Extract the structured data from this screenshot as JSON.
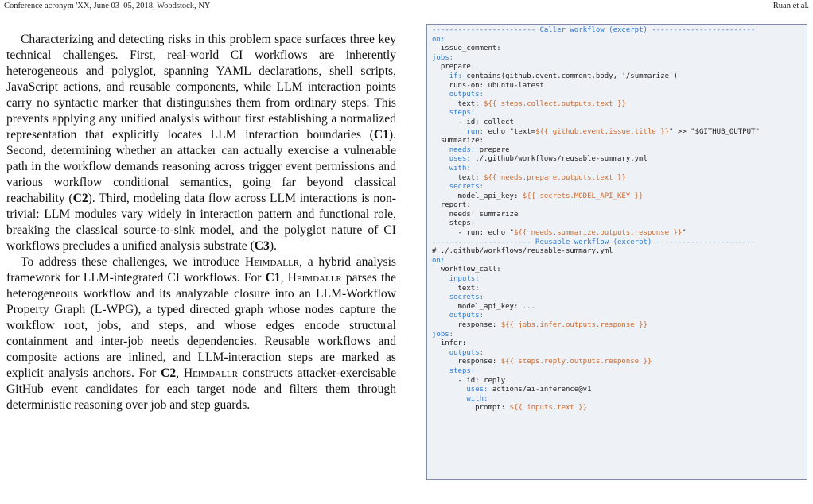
{
  "header": {
    "left": "Conference acronym 'XX, June 03–05, 2018, Woodstock, NY",
    "right": "Ruan et al."
  },
  "body": {
    "p1_segments": [
      {
        "t": "Characterizing and detecting risks in this problem space surfaces three key technical challenges. First, real-world CI workflows are inherently heterogeneous and polyglot, spanning YAML declarations, shell scripts, JavaScript actions, and reusable components, while LLM interaction points carry no syntactic marker that distinguishes them from ordinary steps. This prevents applying any unified analysis without first establishing a normalized representation that explicitly locates LLM interaction boundaries (",
        "s": ""
      },
      {
        "t": "C1",
        "s": "b"
      },
      {
        "t": "). Second, determining whether an attacker can actually exercise a vulnerable path in the workflow demands reasoning across trigger event permissions and various workflow conditional semantics, going far beyond classical reachability (",
        "s": ""
      },
      {
        "t": "C2",
        "s": "b"
      },
      {
        "t": "). Third, modeling data flow across LLM interactions is non-trivial: LLM modules vary widely in interaction pattern and functional role, breaking the classical source-to-sink model, and the polyglot nature of CI workflows precludes a unified analysis substrate (",
        "s": ""
      },
      {
        "t": "C3",
        "s": "b"
      },
      {
        "t": ").",
        "s": ""
      }
    ],
    "p2_segments": [
      {
        "t": "To address these challenges, we introduce ",
        "s": ""
      },
      {
        "t": "Heimdallr",
        "s": "sc"
      },
      {
        "t": ", a hybrid analysis framework for LLM-integrated CI workflows. For ",
        "s": ""
      },
      {
        "t": "C1",
        "s": "b"
      },
      {
        "t": ", ",
        "s": ""
      },
      {
        "t": "Heimdallr",
        "s": "sc"
      },
      {
        "t": " parses the heterogeneous workflow and its analyzable closure into an LLM-Workflow Property Graph (L-WPG), a typed directed graph whose nodes capture the workflow root, jobs, and steps, and whose edges encode structural containment and inter-job needs dependencies. Reusable workflows and composite actions are inlined, and LLM-interaction steps are marked as explicit analysis anchors. For ",
        "s": ""
      },
      {
        "t": "C2",
        "s": "b"
      },
      {
        "t": ", ",
        "s": ""
      },
      {
        "t": "Heimdallr",
        "s": "sc"
      },
      {
        "t": " constructs attacker-exercisable GitHub event candidates for each target node and filters them through deterministic reasoning over job and step guards.",
        "s": ""
      }
    ]
  },
  "code_lines": [
    [
      {
        "t": "------------------------ Caller workflow (excerpt) ------------------------",
        "c": "sep"
      }
    ],
    [
      {
        "t": "on:",
        "c": "kw"
      }
    ],
    [
      {
        "t": "  issue_comment:",
        "c": ""
      }
    ],
    [
      {
        "t": "jobs:",
        "c": "kw"
      }
    ],
    [
      {
        "t": "  prepare:",
        "c": ""
      }
    ],
    [
      {
        "t": "    ",
        "c": ""
      },
      {
        "t": "if:",
        "c": "kw"
      },
      {
        "t": " contains(github.event.comment.body, '/summarize')",
        "c": ""
      }
    ],
    [
      {
        "t": "    runs-on: ubuntu-latest",
        "c": ""
      }
    ],
    [
      {
        "t": "    ",
        "c": ""
      },
      {
        "t": "outputs:",
        "c": "kw"
      }
    ],
    [
      {
        "t": "      text: ",
        "c": ""
      },
      {
        "t": "${{ steps.collect.outputs.text }}",
        "c": "st"
      }
    ],
    [
      {
        "t": "    ",
        "c": ""
      },
      {
        "t": "steps:",
        "c": "kw"
      }
    ],
    [
      {
        "t": "      - id: collect",
        "c": ""
      }
    ],
    [
      {
        "t": "        ",
        "c": ""
      },
      {
        "t": "run:",
        "c": "kw"
      },
      {
        "t": " echo \"text=",
        "c": ""
      },
      {
        "t": "${{ github.event.issue.title }}",
        "c": "st"
      },
      {
        "t": "\" >> \"$GITHUB_OUTPUT\"",
        "c": ""
      }
    ],
    [
      {
        "t": "  summarize:",
        "c": ""
      }
    ],
    [
      {
        "t": "    ",
        "c": ""
      },
      {
        "t": "needs:",
        "c": "kw"
      },
      {
        "t": " prepare",
        "c": ""
      }
    ],
    [
      {
        "t": "    ",
        "c": ""
      },
      {
        "t": "uses:",
        "c": "kw"
      },
      {
        "t": " ./.github/workflows/reusable-summary.yml",
        "c": ""
      }
    ],
    [
      {
        "t": "    ",
        "c": ""
      },
      {
        "t": "with:",
        "c": "kw"
      }
    ],
    [
      {
        "t": "      text: ",
        "c": ""
      },
      {
        "t": "${{ needs.prepare.outputs.text }}",
        "c": "st"
      }
    ],
    [
      {
        "t": "    ",
        "c": ""
      },
      {
        "t": "secrets:",
        "c": "kw"
      }
    ],
    [
      {
        "t": "      model_api_key: ",
        "c": ""
      },
      {
        "t": "${{ secrets.MODEL_API_KEY }}",
        "c": "st"
      }
    ],
    [
      {
        "t": "  report:",
        "c": ""
      }
    ],
    [
      {
        "t": "    needs: summarize",
        "c": ""
      }
    ],
    [
      {
        "t": "    steps:",
        "c": ""
      }
    ],
    [
      {
        "t": "      - run: echo \"",
        "c": ""
      },
      {
        "t": "${{ needs.summarize.outputs.response }}",
        "c": "st"
      },
      {
        "t": "\"",
        "c": ""
      }
    ],
    [
      {
        "t": "----------------------- Reusable workflow (excerpt) -----------------------",
        "c": "sep"
      }
    ],
    [
      {
        "t": "# ./.github/workflows/reusable-summary.yml",
        "c": ""
      }
    ],
    [
      {
        "t": "on:",
        "c": "kw"
      }
    ],
    [
      {
        "t": "  workflow_call:",
        "c": ""
      }
    ],
    [
      {
        "t": "    ",
        "c": ""
      },
      {
        "t": "inputs:",
        "c": "kw"
      }
    ],
    [
      {
        "t": "      text:",
        "c": ""
      }
    ],
    [
      {
        "t": "    ",
        "c": ""
      },
      {
        "t": "secrets:",
        "c": "kw"
      }
    ],
    [
      {
        "t": "      model_api_key: ...",
        "c": ""
      }
    ],
    [
      {
        "t": "    ",
        "c": ""
      },
      {
        "t": "outputs:",
        "c": "kw"
      }
    ],
    [
      {
        "t": "      response: ",
        "c": ""
      },
      {
        "t": "${{ jobs.infer.outputs.response }}",
        "c": "st"
      }
    ],
    [
      {
        "t": "jobs:",
        "c": "kw"
      }
    ],
    [
      {
        "t": "  infer:",
        "c": ""
      }
    ],
    [
      {
        "t": "    ",
        "c": ""
      },
      {
        "t": "outputs:",
        "c": "kw"
      }
    ],
    [
      {
        "t": "      response: ",
        "c": ""
      },
      {
        "t": "${{ steps.reply.outputs.response }}",
        "c": "st"
      }
    ],
    [
      {
        "t": "    ",
        "c": ""
      },
      {
        "t": "steps:",
        "c": "kw"
      }
    ],
    [
      {
        "t": "      - id: reply",
        "c": ""
      }
    ],
    [
      {
        "t": "        ",
        "c": ""
      },
      {
        "t": "uses:",
        "c": "kw"
      },
      {
        "t": " actions/ai-inference@v1",
        "c": ""
      }
    ],
    [
      {
        "t": "        ",
        "c": ""
      },
      {
        "t": "with:",
        "c": "kw"
      }
    ],
    [
      {
        "t": "          prompt: ",
        "c": ""
      },
      {
        "t": "${{ inputs.text }}",
        "c": "st"
      }
    ]
  ]
}
